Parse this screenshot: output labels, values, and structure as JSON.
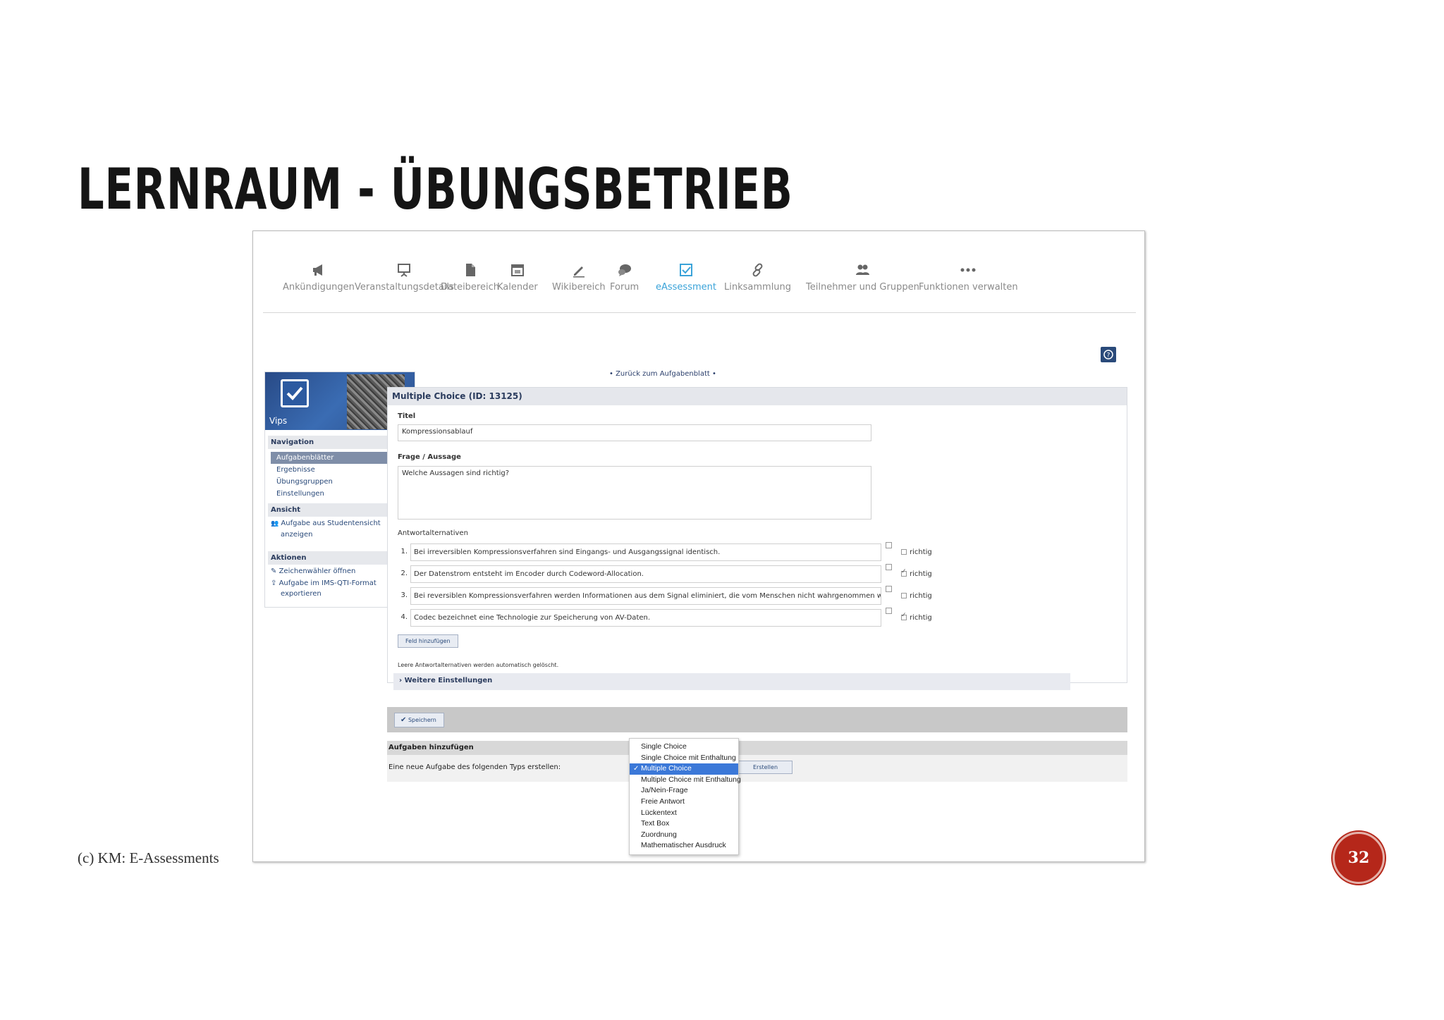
{
  "slide": {
    "title": "LERNRAUM - ÜBUNGSBETRIEB",
    "footer": "(c) KM: E-Assessments",
    "page_number": "32"
  },
  "topnav": {
    "items": [
      {
        "label": "Ankündigungen",
        "icon": "megaphone-icon"
      },
      {
        "label": "Veranstaltungsdetails",
        "icon": "presentation-icon"
      },
      {
        "label": "Dateibereich",
        "icon": "file-icon"
      },
      {
        "label": "Kalender",
        "icon": "calendar-icon"
      },
      {
        "label": "Wikibereich",
        "icon": "pencil-icon"
      },
      {
        "label": "Forum",
        "icon": "speech-bubbles-icon"
      },
      {
        "label": "eAssessment",
        "icon": "checkbox-icon"
      },
      {
        "label": "Linksammlung",
        "icon": "link-icon"
      },
      {
        "label": "Teilnehmer und Gruppen",
        "icon": "people-icon"
      },
      {
        "label": "Funktionen verwalten",
        "icon": "more-dots-icon"
      }
    ],
    "active_color": "#3aa3d9"
  },
  "sidebar": {
    "banner_label": "Vips",
    "navigation": {
      "heading": "Navigation",
      "items": [
        "Aufgabenblätter",
        "Ergebnisse",
        "Übungsgruppen",
        "Einstellungen"
      ]
    },
    "view": {
      "heading": "Ansicht",
      "item_line1": "Aufgabe aus Studentensicht",
      "item_line2": "anzeigen"
    },
    "actions": {
      "heading": "Aktionen",
      "item1": "Zeichenwähler öffnen",
      "item2_line1": "Aufgabe im IMS-QTI-Format",
      "item2_line2": "exportieren"
    }
  },
  "main": {
    "back_link": "• Zurück zum Aufgabenblatt •",
    "panel_title": "Multiple Choice (ID: 13125)",
    "title_label": "Titel",
    "title_value": "Kompressionsablauf",
    "question_label": "Frage / Aussage",
    "question_value": "Welche Aussagen sind richtig?",
    "answers_label": "Antwortalternativen",
    "answers": [
      {
        "num": "1.",
        "text": "Bei irreversiblen Kompressionsverfahren sind Eingangs- und Ausgangssignal identisch.",
        "correct_label": "richtig"
      },
      {
        "num": "2.",
        "text": "Der Datenstrom entsteht im Encoder durch Codeword-Allocation.",
        "correct_label": "richtig"
      },
      {
        "num": "3.",
        "text": "Bei reversiblen Kompressionsverfahren werden Informationen aus dem Signal eliminiert, die vom Menschen nicht wahrgenommen werden",
        "correct_label": "richtig"
      },
      {
        "num": "4.",
        "text": "Codec bezeichnet eine Technologie zur Speicherung von AV-Daten.",
        "correct_label": "richtig"
      }
    ],
    "add_field_button": "Feld hinzufügen",
    "empty_hint": "Leere Antwortalternativen werden automatisch gelöscht.",
    "more_settings": "Weitere Einstellungen",
    "save_button": "Speichern",
    "add_tasks_heading": "Aufgaben hinzufügen",
    "add_task_label": "Eine neue Aufgabe des folgenden Typs erstellen:",
    "create_button": "Erstellen",
    "type_options": [
      "Single Choice",
      "Single Choice mit Enthaltung",
      "Multiple Choice",
      "Multiple Choice mit Enthaltung",
      "Ja/Nein-Frage",
      "Freie Antwort",
      "Lückentext",
      "Text Box",
      "Zuordnung",
      "Mathematischer Ausdruck"
    ],
    "selected_type": "Multiple Choice"
  }
}
